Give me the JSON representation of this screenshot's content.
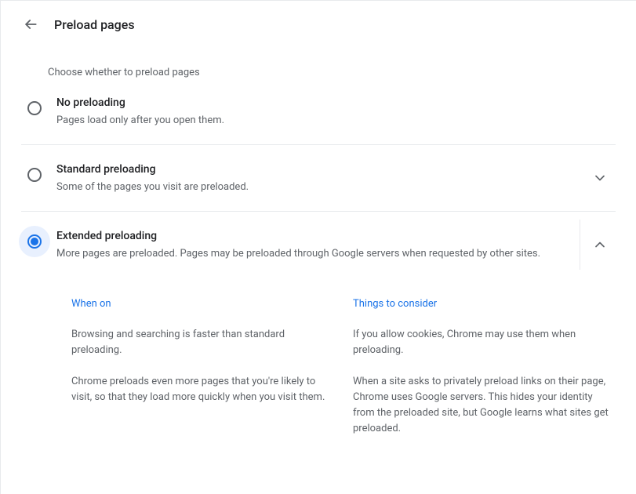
{
  "header": {
    "title": "Preload pages"
  },
  "subtitle": "Choose whether to preload pages",
  "options": [
    {
      "title": "No preloading",
      "desc": "Pages load only after you open them."
    },
    {
      "title": "Standard preloading",
      "desc": "Some of the pages you visit are preloaded."
    },
    {
      "title": "Extended preloading",
      "desc": "More pages are preloaded. Pages may be preloaded through Google servers when requested by other sites."
    }
  ],
  "details": {
    "col1": {
      "heading": "When on",
      "p1": "Browsing and searching is faster than standard preloading.",
      "p2": "Chrome preloads even more pages that you're likely to visit, so that they load more quickly when you visit them."
    },
    "col2": {
      "heading": "Things to consider",
      "p1": "If you allow cookies, Chrome may use them when preloading.",
      "p2": "When a site asks to privately preload links on their page, Chrome uses Google servers. This hides your identity from the preloaded site, but Google learns what sites get preloaded."
    }
  }
}
